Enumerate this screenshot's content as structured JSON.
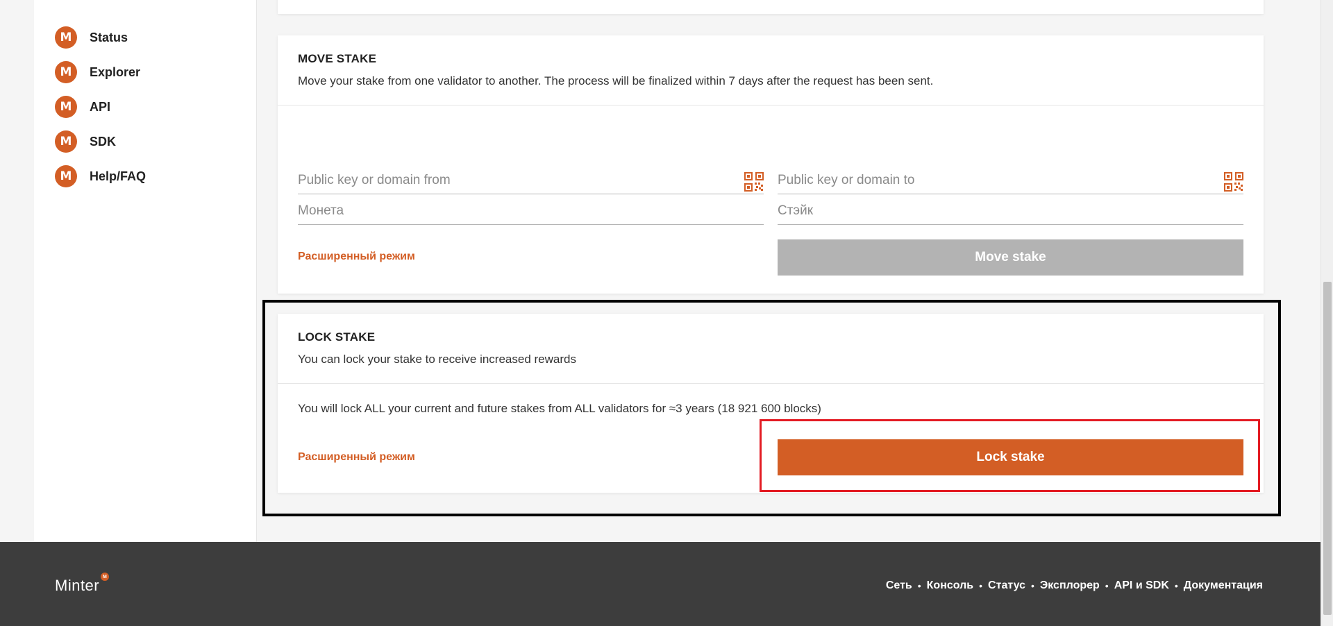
{
  "sidebar": {
    "items": [
      {
        "label": "Status"
      },
      {
        "label": "Explorer"
      },
      {
        "label": "API"
      },
      {
        "label": "SDK"
      },
      {
        "label": "Help/FAQ"
      }
    ]
  },
  "move_stake": {
    "title": "MOVE STAKE",
    "description": "Move your stake from one validator to another. The process will be finalized within 7 days after the request has been sent.",
    "from_placeholder": "Public key or domain from",
    "to_placeholder": "Public key or domain to",
    "coin_placeholder": "Монета",
    "stake_placeholder": "Стэйк",
    "advanced_link": "Расширенный режим",
    "button_label": "Move stake"
  },
  "lock_stake": {
    "title": "LOCK STAKE",
    "description": "You can lock your stake to receive increased rewards",
    "info": "You will lock ALL your current and future stakes from ALL validators for ≈3 years (18 921 600 blocks)",
    "advanced_link": "Расширенный режим",
    "button_label": "Lock stake"
  },
  "footer": {
    "logo": "Minter",
    "links": [
      {
        "label": "Сеть"
      },
      {
        "label": "Консоль"
      },
      {
        "label": "Статус"
      },
      {
        "label": "Эксплорер"
      },
      {
        "label": "API и SDK"
      },
      {
        "label": "Документация"
      }
    ]
  },
  "colors": {
    "accent": "#d35e25",
    "disabled_button": "#b3b3b3",
    "footer_bg": "#3d3d3d",
    "highlight_outer": "#000000",
    "highlight_inner": "#e31b23"
  }
}
